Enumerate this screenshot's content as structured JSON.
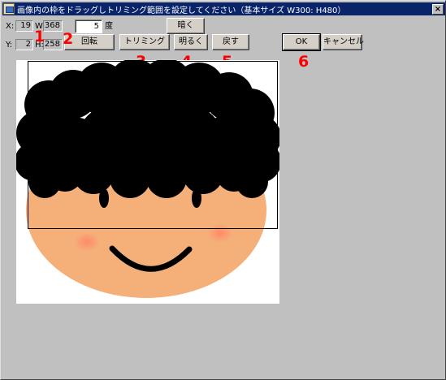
{
  "window": {
    "title": "画像内の枠をドラッグしトリミング範囲を設定してください（基本サイズ W300: H480）",
    "close_glyph": "×",
    "icon": "app-icon"
  },
  "position": {
    "x_label": "X:",
    "x_value": "19",
    "y_label": "Y:",
    "y_value": "2"
  },
  "size": {
    "w_label": "W:",
    "w_value": "368",
    "h_label": "H:",
    "h_value": "258"
  },
  "rotation": {
    "degree_value": "5",
    "degree_unit": "度",
    "rotate_label": "回転"
  },
  "buttons": {
    "trim": "トリミング",
    "darker": "暗く",
    "brighter": "明るく",
    "back": "戻す",
    "ok": "OK",
    "cancel": "キャンセル"
  },
  "annotations": [
    "1",
    "2",
    "3",
    "4",
    "5",
    "6"
  ],
  "image": {
    "subject": "cartoon boy face",
    "colors": {
      "skin": "#f5b07a",
      "hair": "#000000",
      "cheek": "#ff8a6a",
      "background": "#ffffff"
    }
  },
  "colors": {
    "dialog_bg": "#c0c0c0",
    "titlebar": "#0a246a",
    "annotation": "#ff0000"
  }
}
